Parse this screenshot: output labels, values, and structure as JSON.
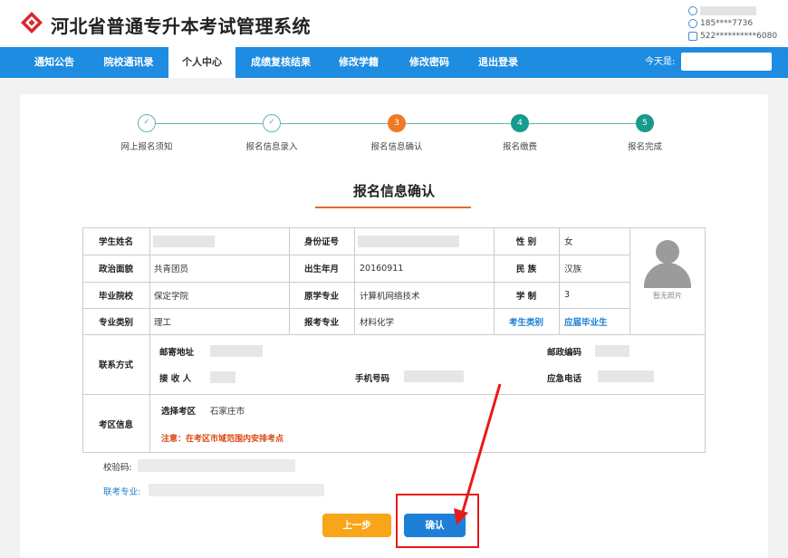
{
  "header": {
    "title": "河北省普通专升本考试管理系统",
    "user_phone": "185****7736",
    "user_id": "522**********6080"
  },
  "nav": {
    "items": [
      "通知公告",
      "院校通讯录",
      "个人中心",
      "成绩复核结果",
      "修改学籍",
      "修改密码",
      "退出登录"
    ],
    "active_index": 2,
    "today_label": "今天是:"
  },
  "steps": {
    "items": [
      {
        "label": "网上报名须知",
        "state": "done",
        "number": "✓"
      },
      {
        "label": "报名信息录入",
        "state": "done",
        "number": "✓"
      },
      {
        "label": "报名信息确认",
        "state": "current",
        "number": "3"
      },
      {
        "label": "报名缴费",
        "state": "todo",
        "number": "4"
      },
      {
        "label": "报名完成",
        "state": "todo",
        "number": "5"
      }
    ]
  },
  "page_title": "报名信息确认",
  "form": {
    "student_name_label": "学生姓名",
    "id_label": "身份证号",
    "gender_label": "性 别",
    "gender": "女",
    "political_label": "政治面貌",
    "political": "共青团员",
    "birth_label": "出生年月",
    "birth": "20160911",
    "ethnic_label": "民 族",
    "ethnic": "汉族",
    "school_label": "毕业院校",
    "school": "保定学院",
    "orig_major_label": "原学专业",
    "orig_major": "计算机网络技术",
    "system_label": "学 制",
    "system": "3",
    "category_label": "专业类别",
    "category": "理工",
    "apply_major_label": "报考专业",
    "apply_major": "材料化学",
    "exam_type_label": "考生类别",
    "exam_type": "应届毕业生",
    "photo_label": "暂无照片",
    "contact_label": "联系方式",
    "address_label": "邮寄地址",
    "postcode_label": "邮政编码",
    "receiver_label": "接 收 人",
    "mobile_label": "手机号码",
    "emergency_label": "应急电话",
    "region_section_label": "考区信息",
    "region_label": "选择考区",
    "region": "石家庄市",
    "notice": "注意：在考区市域范围内安排考点"
  },
  "extra": {
    "verify_label": "校验码:",
    "joint_major_label": "联考专业:"
  },
  "buttons": {
    "prev": "上一步",
    "confirm": "确认"
  },
  "colors": {
    "nav_blue": "#1e8ce0",
    "step_done": "#5fb8b0",
    "step_current": "#f07a24",
    "step_todo": "#179b8c",
    "notice_red": "#d9480f",
    "highlight_red": "#e8191a"
  }
}
